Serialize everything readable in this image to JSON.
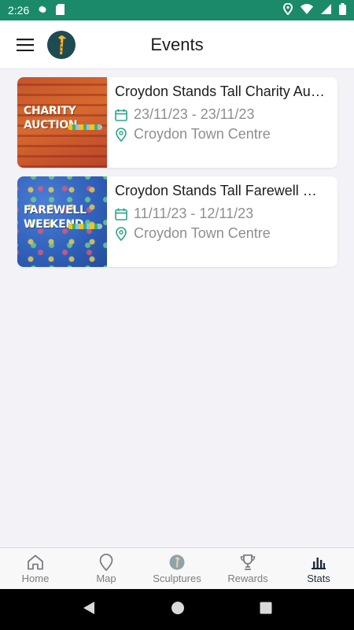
{
  "status_bar": {
    "time": "2:26"
  },
  "header": {
    "title": "Events"
  },
  "events": [
    {
      "title": "Croydon Stands Tall Charity Auction",
      "dates": "23/11/23 - 23/11/23",
      "location": "Croydon Town Centre",
      "thumb_text_line1": "CHARITY",
      "thumb_text_line2": "AUCTION"
    },
    {
      "title": "Croydon Stands Tall Farewell Weekend",
      "dates": "11/11/23 - 12/11/23",
      "location": "Croydon Town Centre",
      "thumb_text_line1": "FAREWELL",
      "thumb_text_line2": "WEEKEND"
    }
  ],
  "tabs": [
    {
      "label": "Home",
      "icon": "home-icon",
      "active": false
    },
    {
      "label": "Map",
      "icon": "map-pin-icon",
      "active": false
    },
    {
      "label": "Sculptures",
      "icon": "sculpture-icon",
      "active": false
    },
    {
      "label": "Rewards",
      "icon": "trophy-icon",
      "active": false
    },
    {
      "label": "Stats",
      "icon": "bar-chart-icon",
      "active": true
    }
  ],
  "colors": {
    "status_bar": "#1b8a6b",
    "accent": "#2aa58a",
    "tab_active": "#1e2a3a"
  }
}
